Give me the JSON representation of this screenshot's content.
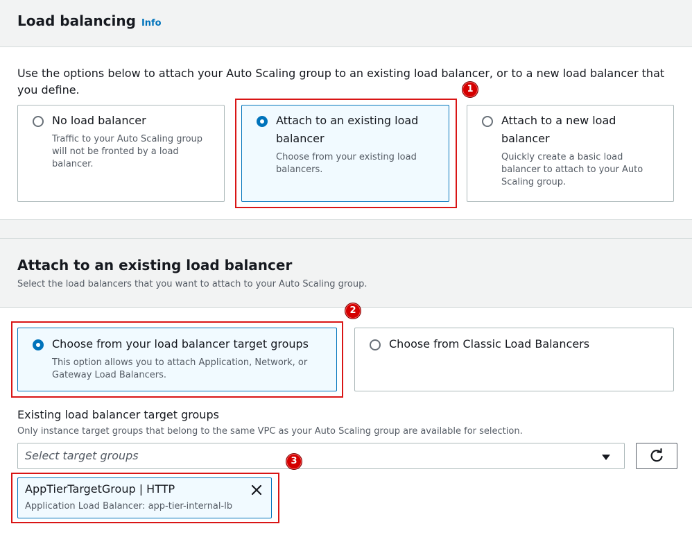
{
  "section1": {
    "title": "Load balancing",
    "info": "Info",
    "description_line1": "Use the options below to attach your Auto Scaling group to an existing load balancer, or to a new load balancer that",
    "description_line2": "you define.",
    "options": [
      {
        "title": "No load balancer",
        "desc_lines": [
          "Traffic to your Auto Scaling group",
          "will not be fronted by a load",
          "balancer."
        ],
        "selected": false
      },
      {
        "title_lines": [
          "Attach to an existing load",
          "balancer"
        ],
        "desc_lines": [
          "Choose from your existing load",
          "balancers."
        ],
        "selected": true
      },
      {
        "title_lines": [
          "Attach to a new load",
          "balancer"
        ],
        "desc_lines": [
          "Quickly create a basic load",
          "balancer to attach to your Auto",
          "Scaling group."
        ],
        "selected": false
      }
    ]
  },
  "section2": {
    "title": "Attach to an existing load balancer",
    "subtitle": "Select the load balancers that you want to attach to your Auto Scaling group.",
    "options": [
      {
        "title": "Choose from your load balancer target groups",
        "desc_lines": [
          "This option allows you to attach Application, Network, or",
          "Gateway Load Balancers."
        ],
        "selected": true
      },
      {
        "title": "Choose from Classic Load Balancers",
        "selected": false
      }
    ],
    "field_label": "Existing load balancer target groups",
    "field_hint": "Only instance target groups that belong to the same VPC as your Auto Scaling group are available for selection.",
    "select_placeholder": "Select target groups",
    "token": {
      "title": "AppTierTargetGroup | HTTP",
      "desc": "Application Load Balancer: app-tier-internal-lb"
    }
  },
  "badges": [
    "1",
    "2",
    "3"
  ],
  "colors": {
    "accent": "#0073bb",
    "highlight": "#d91515",
    "badge": "#d40000",
    "band": "#f2f3f3"
  },
  "icons": {
    "refresh": "refresh-icon",
    "close": "close-icon",
    "caret": "caret-down-icon"
  }
}
